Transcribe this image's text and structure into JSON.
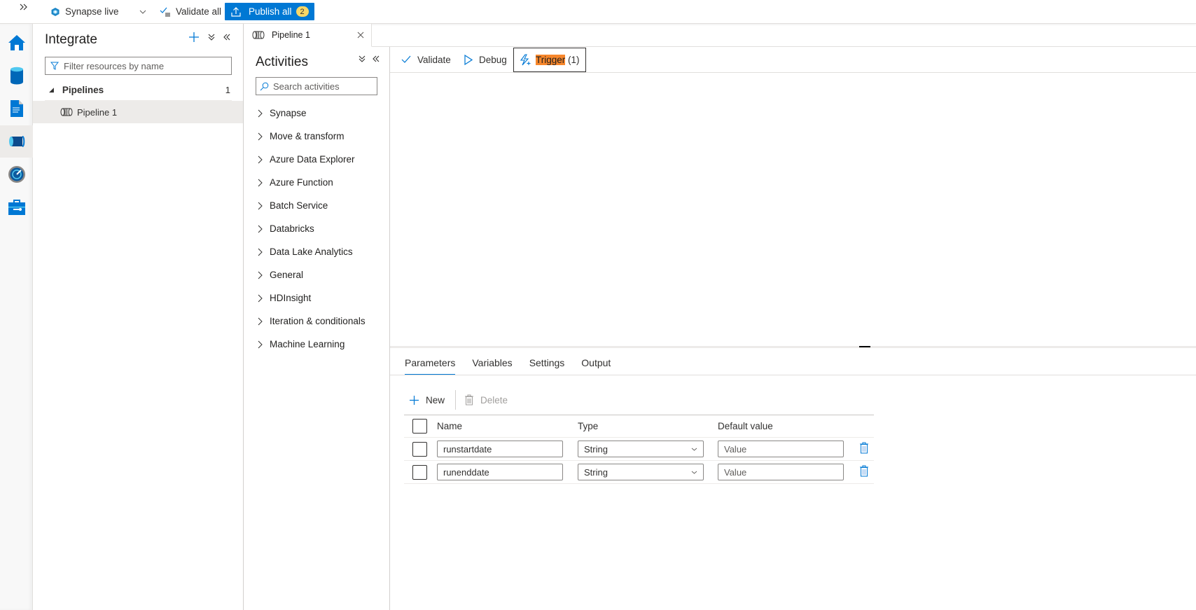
{
  "topbar": {
    "expand_icon": "double-chevron-right-icon",
    "mode_label": "Synapse live",
    "validate_all_label": "Validate all",
    "publish_all_label": "Publish all",
    "publish_badge_count": "2",
    "colors": {
      "accent": "#0078d4",
      "badge": "#f8d767"
    }
  },
  "rail": {
    "items": [
      {
        "name": "home",
        "icon": "home-icon"
      },
      {
        "name": "data",
        "icon": "database-icon"
      },
      {
        "name": "develop",
        "icon": "document-icon"
      },
      {
        "name": "integrate",
        "icon": "pipeline-icon",
        "active": true
      },
      {
        "name": "monitor",
        "icon": "gauge-icon"
      },
      {
        "name": "manage",
        "icon": "toolbox-icon"
      }
    ]
  },
  "integrate": {
    "title": "Integrate",
    "filter_placeholder": "Filter resources by name",
    "tree": {
      "header": "Pipelines",
      "count": "1",
      "items": [
        {
          "label": "Pipeline 1",
          "icon": "pipeline-icon"
        }
      ]
    }
  },
  "editor": {
    "tab_title": "Pipeline 1"
  },
  "activities": {
    "title": "Activities",
    "search_placeholder": "Search activities",
    "groups": [
      "Synapse",
      "Move & transform",
      "Azure Data Explorer",
      "Azure Function",
      "Batch Service",
      "Databricks",
      "Data Lake Analytics",
      "General",
      "HDInsight",
      "Iteration & conditionals",
      "Machine Learning"
    ]
  },
  "canvas_toolbar": {
    "validate_label": "Validate",
    "debug_label": "Debug",
    "trigger_label": "Trigger",
    "trigger_count": "(1)",
    "highlight_color": "#f7872c"
  },
  "bottom_panel": {
    "tabs": [
      {
        "label": "Parameters",
        "active": true
      },
      {
        "label": "Variables"
      },
      {
        "label": "Settings"
      },
      {
        "label": "Output"
      }
    ],
    "new_label": "New",
    "delete_label": "Delete",
    "columns": {
      "name": "Name",
      "type": "Type",
      "default": "Default value"
    },
    "default_placeholder": "Value",
    "rows": [
      {
        "name": "runstartdate",
        "type": "String",
        "default": ""
      },
      {
        "name": "runenddate",
        "type": "String",
        "default": ""
      }
    ]
  }
}
